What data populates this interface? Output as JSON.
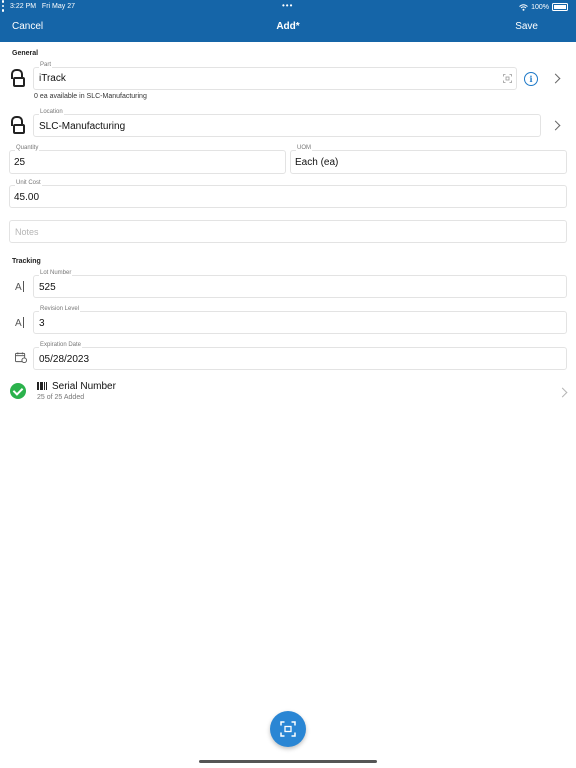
{
  "status_bar": {
    "time": "3:22 PM",
    "date": "Fri May 27",
    "dots": "•••",
    "battery": "100%"
  },
  "nav": {
    "cancel_label": "Cancel",
    "title": "Add*",
    "save_label": "Save"
  },
  "general": {
    "section_title": "General",
    "part": {
      "label": "Part",
      "value": "iTrack",
      "helper": "0 ea available in SLC-Manufacturing"
    },
    "location": {
      "label": "Location",
      "value": "SLC-Manufacturing"
    },
    "quantity": {
      "label": "Quantity",
      "value": "25"
    },
    "uom": {
      "label": "UOM",
      "value": "Each (ea)"
    },
    "unit_cost": {
      "label": "Unit Cost",
      "value": "45.00"
    },
    "notes": {
      "placeholder": "Notes"
    }
  },
  "tracking": {
    "section_title": "Tracking",
    "lot_number": {
      "label": "Lot Number",
      "value": "525"
    },
    "revision_level": {
      "label": "Revision Level",
      "value": "3"
    },
    "expiration_date": {
      "label": "Expiration Date",
      "value": "05/28/2023"
    },
    "serial_number": {
      "title": "Serial Number",
      "subtitle": "25 of 25 Added"
    }
  },
  "icons": {
    "text_field": "A",
    "info": "i"
  },
  "colors": {
    "header": "#1565a8",
    "accent": "#1e79c8",
    "success": "#2bb24c",
    "fab": "#2a86d4"
  }
}
